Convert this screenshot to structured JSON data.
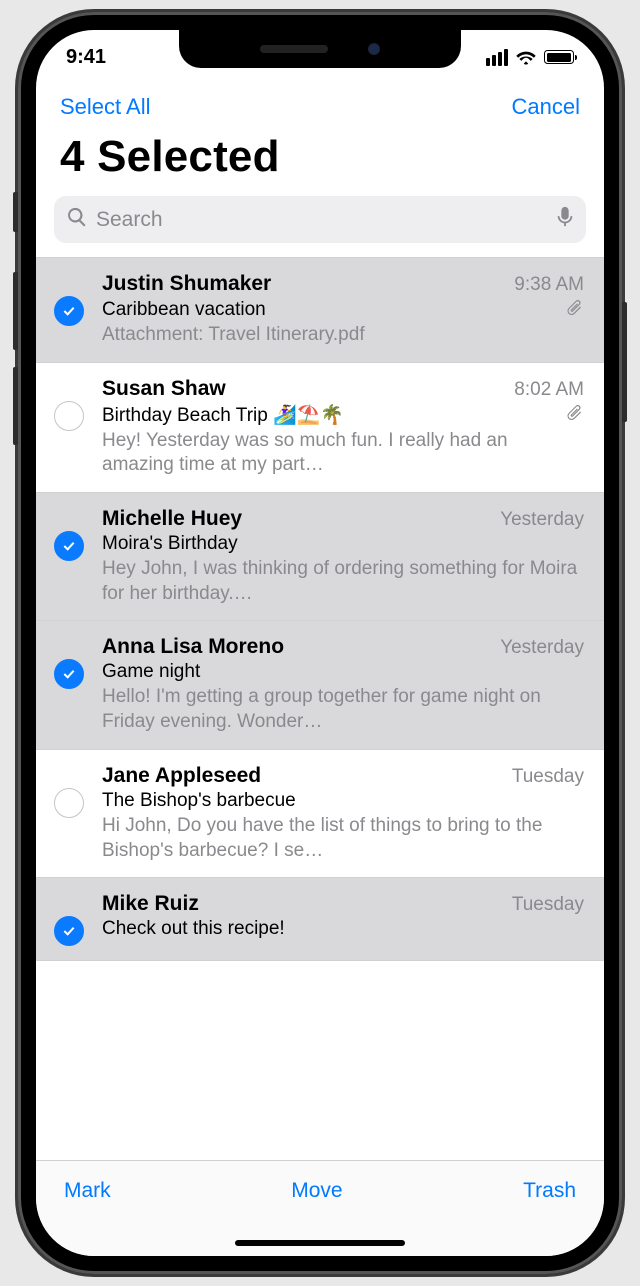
{
  "status": {
    "time": "9:41"
  },
  "nav": {
    "select_all": "Select All",
    "cancel": "Cancel"
  },
  "title": "4 Selected",
  "search": {
    "placeholder": "Search"
  },
  "toolbar": {
    "mark": "Mark",
    "move": "Move",
    "trash": "Trash"
  },
  "emails": [
    {
      "selected": true,
      "sender": "Justin Shumaker",
      "time": "9:38 AM",
      "subject": "Caribbean vacation",
      "has_attachment": true,
      "preview": "Attachment: Travel Itinerary.pdf"
    },
    {
      "selected": false,
      "sender": "Susan Shaw",
      "time": "8:02 AM",
      "subject": "Birthday Beach Trip 🏄‍♀️⛱️🌴",
      "has_attachment": true,
      "preview": "Hey! Yesterday was so much fun. I really had an amazing time at my part…"
    },
    {
      "selected": true,
      "sender": "Michelle Huey",
      "time": "Yesterday",
      "subject": "Moira's Birthday",
      "has_attachment": false,
      "preview": "Hey John, I was thinking of ordering something for Moira for her birthday.…"
    },
    {
      "selected": true,
      "sender": "Anna Lisa Moreno",
      "time": "Yesterday",
      "subject": "Game night",
      "has_attachment": false,
      "preview": "Hello! I'm getting a group together for game night on Friday evening. Wonder…"
    },
    {
      "selected": false,
      "sender": "Jane Appleseed",
      "time": "Tuesday",
      "subject": "The Bishop's barbecue",
      "has_attachment": false,
      "preview": "Hi John, Do you have the list of things to bring to the Bishop's barbecue? I se…"
    },
    {
      "selected": true,
      "sender": "Mike Ruiz",
      "time": "Tuesday",
      "subject": "Check out this recipe!",
      "has_attachment": false,
      "preview": ""
    }
  ]
}
